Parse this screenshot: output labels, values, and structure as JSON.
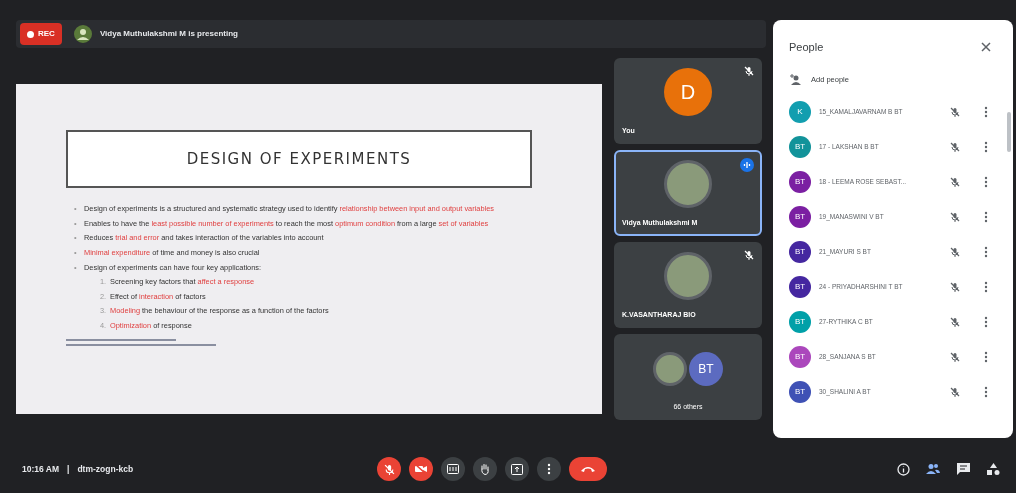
{
  "recording": {
    "label": "REC"
  },
  "presenting_banner": {
    "text": "Vidya Muthulakshmi M is presenting"
  },
  "slide": {
    "title": "DESIGN OF EXPERIMENTS",
    "bullets": [
      {
        "marker": "•",
        "segments": [
          {
            "text": "Design of experiments is a structured and systematic strategy used to identify ",
            "emphasis": false
          },
          {
            "text": "relationship between input and output variables",
            "emphasis": true
          }
        ]
      },
      {
        "marker": "•",
        "segments": [
          {
            "text": "Enables to have the ",
            "emphasis": false
          },
          {
            "text": "least possible number of experiments",
            "emphasis": true
          },
          {
            "text": " to reach the most ",
            "emphasis": false
          },
          {
            "text": "optimum condition",
            "emphasis": true
          },
          {
            "text": " from a large ",
            "emphasis": false
          },
          {
            "text": "set of variables",
            "emphasis": true
          }
        ]
      },
      {
        "marker": "•",
        "segments": [
          {
            "text": "Reduces ",
            "emphasis": false
          },
          {
            "text": "trial and error",
            "emphasis": true
          },
          {
            "text": " and takes interaction of the variables into account",
            "emphasis": false
          }
        ]
      },
      {
        "marker": "•",
        "segments": [
          {
            "text": "Minimal expenditure",
            "emphasis": true
          },
          {
            "text": " of time and money is also crucial",
            "emphasis": false
          }
        ]
      },
      {
        "marker": "•",
        "segments": [
          {
            "text": "Design of experiments can have four key applications:",
            "emphasis": false
          }
        ],
        "children": [
          {
            "marker": "1.",
            "segments": [
              {
                "text": "Screening key factors that ",
                "emphasis": false
              },
              {
                "text": "affect a response",
                "emphasis": true
              }
            ]
          },
          {
            "marker": "2.",
            "segments": [
              {
                "text": "Effect of ",
                "emphasis": false
              },
              {
                "text": "interaction",
                "emphasis": true
              },
              {
                "text": " of factors",
                "emphasis": false
              }
            ]
          },
          {
            "marker": "3.",
            "segments": [
              {
                "text": "Modeling",
                "emphasis": true
              },
              {
                "text": " the behaviour of the response as a function of the factors",
                "emphasis": false
              }
            ]
          },
          {
            "marker": "4.",
            "segments": [
              {
                "text": "Optimization",
                "emphasis": true
              },
              {
                "text": " of response",
                "emphasis": false
              }
            ]
          }
        ]
      }
    ]
  },
  "tiles": [
    {
      "kind": "initial",
      "name": "You",
      "initial": "D",
      "color": "#e8710a",
      "muted": true,
      "speaking": false
    },
    {
      "kind": "photo",
      "name": "Vidya Muthulakshmi M",
      "muted": false,
      "speaking": true
    },
    {
      "kind": "photo",
      "name": "K.VASANTHARAJ BIO",
      "muted": true,
      "speaking": false
    },
    {
      "kind": "group",
      "name": "66 others",
      "initials": "BT",
      "color": "#5c6bc0",
      "muted": false,
      "speaking": false
    }
  ],
  "people_panel": {
    "title": "People",
    "add_label": "Add people",
    "participants": [
      {
        "initials": "K",
        "name": "15_KAMALJAVARNAM B BT",
        "color": "#129eaf"
      },
      {
        "initials": "BT",
        "name": "17 - LAKSHAN B BT",
        "color": "#12939a"
      },
      {
        "initials": "BT",
        "name": "18 - LEEMA ROSE SEBAST...",
        "color": "#7b1fa2"
      },
      {
        "initials": "BT",
        "name": "19_MANASWINI V BT",
        "color": "#7b1fa2"
      },
      {
        "initials": "BT",
        "name": "21_MAYURI S BT",
        "color": "#4527a0"
      },
      {
        "initials": "BT",
        "name": "24 - PRIYADHARSHINI T BT",
        "color": "#4527a0"
      },
      {
        "initials": "BT",
        "name": "27-RYTHIKA C BT",
        "color": "#00a0a8"
      },
      {
        "initials": "BT",
        "name": "28_SANJANA S BT",
        "color": "#ab47bc"
      },
      {
        "initials": "BT",
        "name": "30_SHALINI A BT",
        "color": "#3f51b5"
      }
    ]
  },
  "status": {
    "time": "10:16 AM",
    "separator": "|",
    "meeting_code": "dtm-zogn-kcb"
  },
  "controls": [
    {
      "kind": "mic",
      "off": true
    },
    {
      "kind": "camera",
      "off": true
    },
    {
      "kind": "captions",
      "off": false
    },
    {
      "kind": "hand",
      "off": false
    },
    {
      "kind": "present",
      "off": false
    },
    {
      "kind": "more",
      "off": false
    },
    {
      "kind": "end"
    }
  ],
  "side_controls": [
    {
      "kind": "info",
      "selected": false
    },
    {
      "kind": "people",
      "selected": true
    },
    {
      "kind": "chat",
      "selected": false
    },
    {
      "kind": "activities",
      "selected": false
    }
  ]
}
